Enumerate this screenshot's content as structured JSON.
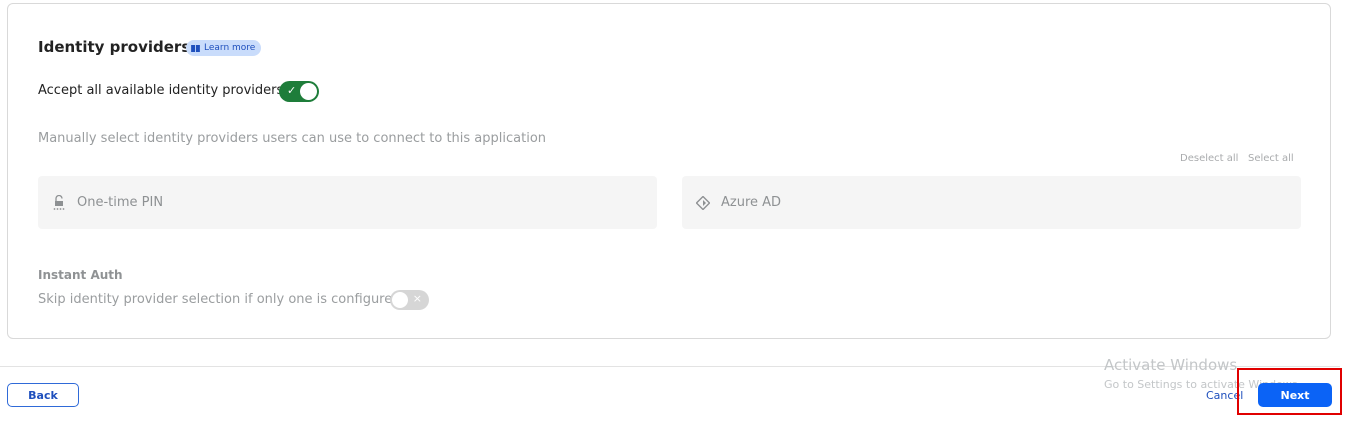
{
  "section": {
    "title": "Identity providers",
    "learn_more": "Learn more",
    "accept_all_label": "Accept all available identity providers",
    "accept_all_enabled": true,
    "manual_label": "Manually select identity providers users can use to connect to this application",
    "deselect_all": "Deselect all",
    "select_all": "Select all",
    "providers": [
      {
        "label": "One-time PIN",
        "icon": "lock-pin-icon"
      },
      {
        "label": "Azure AD",
        "icon": "azure-diamond-icon"
      }
    ],
    "instant_auth": {
      "title": "Instant Auth",
      "label": "Skip identity provider selection if only one is configured",
      "enabled": false
    }
  },
  "footer": {
    "back": "Back",
    "cancel": "Cancel",
    "next": "Next"
  },
  "watermark": {
    "line1": "Activate Windows",
    "line2": "Go to Settings to activate Windows."
  },
  "colors": {
    "toggle_on": "#1e7d3a",
    "primary": "#0b63f6",
    "highlight": "#e00000"
  }
}
